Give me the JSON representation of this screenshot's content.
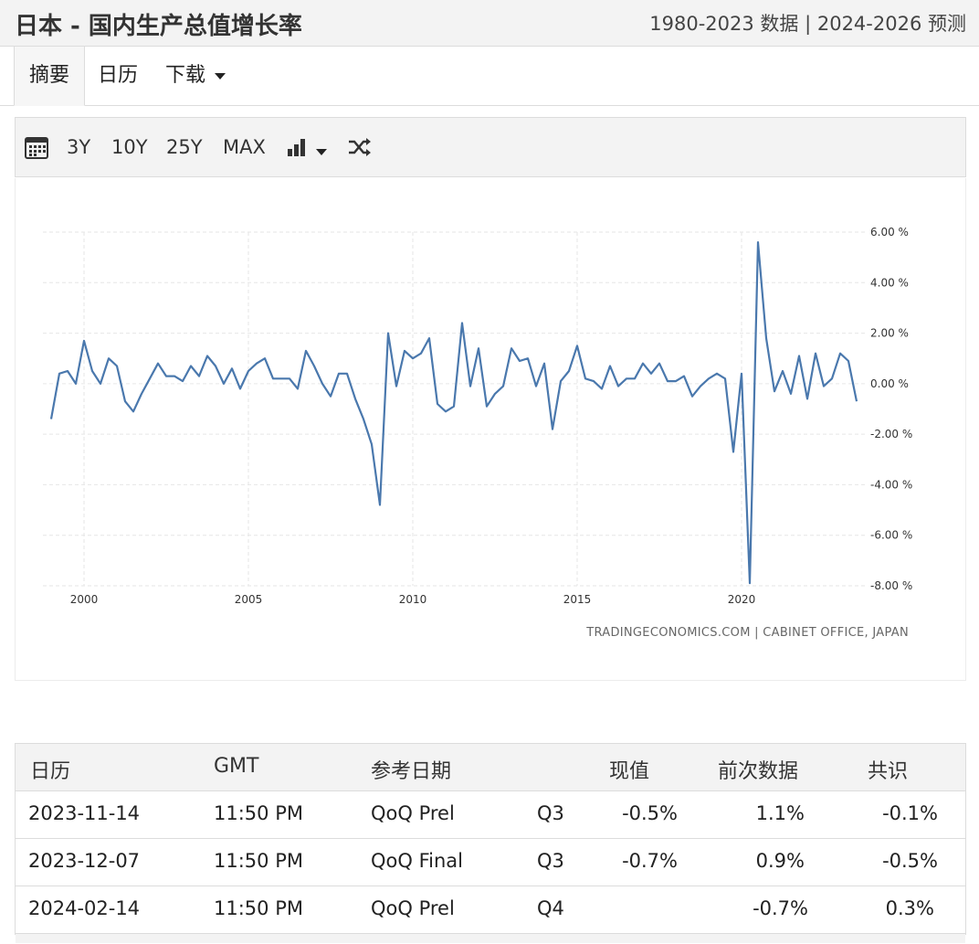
{
  "header": {
    "title": "日本 - 国内生产总值增长率",
    "subtitle": "1980-2023 数据 | 2024-2026 预测"
  },
  "tabs": [
    {
      "label": "摘要",
      "active": true
    },
    {
      "label": "日历"
    },
    {
      "label": "下载"
    }
  ],
  "toolbar": {
    "ranges": [
      "3Y",
      "10Y",
      "25Y",
      "MAX"
    ],
    "icons": [
      "calendar-icon",
      "bar-chart-icon",
      "shuffle-icon"
    ]
  },
  "chart_data": {
    "type": "line",
    "x_start": 1999.0,
    "x_step": 0.25,
    "values": [
      -1.4,
      0.4,
      0.5,
      0.0,
      1.7,
      0.5,
      0.0,
      1.0,
      0.7,
      -0.7,
      -1.1,
      -0.4,
      0.2,
      0.8,
      0.3,
      0.3,
      0.1,
      0.7,
      0.3,
      1.1,
      0.7,
      0.0,
      0.6,
      -0.2,
      0.5,
      0.8,
      1.0,
      0.2,
      0.2,
      0.2,
      -0.2,
      1.3,
      0.7,
      0.0,
      -0.5,
      0.4,
      0.4,
      -0.6,
      -1.4,
      -2.4,
      -4.8,
      2.0,
      -0.1,
      1.3,
      1.0,
      1.2,
      1.8,
      -0.8,
      -1.1,
      -0.9,
      2.4,
      -0.1,
      1.4,
      -0.9,
      -0.4,
      -0.1,
      1.4,
      0.9,
      1.0,
      -0.1,
      0.8,
      -1.8,
      0.1,
      0.5,
      1.5,
      0.2,
      0.1,
      -0.2,
      0.7,
      -0.1,
      0.2,
      0.2,
      0.8,
      0.4,
      0.8,
      0.1,
      0.1,
      0.3,
      -0.5,
      -0.1,
      0.2,
      0.4,
      0.2,
      -2.7,
      0.4,
      -7.9,
      5.6,
      1.8,
      -0.3,
      0.5,
      -0.4,
      1.1,
      -0.6,
      1.2,
      -0.1,
      0.2,
      1.2,
      0.9,
      -0.7
    ],
    "ylim": [
      -8,
      6
    ],
    "y_ticks": [
      "6.00 %",
      "4.00 %",
      "2.00 %",
      "0.00 %",
      "-2.00 %",
      "-4.00 %",
      "-6.00 %",
      "-8.00 %"
    ],
    "y_tick_values": [
      6,
      4,
      2,
      0,
      -2,
      -4,
      -6,
      -8
    ],
    "x_ticks": [
      "2000",
      "2005",
      "2010",
      "2015",
      "2020"
    ],
    "x_tick_values": [
      2000,
      2005,
      2010,
      2015,
      2020
    ],
    "xlim": [
      1998.75,
      2023.75
    ],
    "line_color": "#4a78ad",
    "grid": true,
    "source": "TRADINGECONOMICS.COM | CABINET OFFICE, JAPAN"
  },
  "table": {
    "headers": [
      "日历",
      "GMT",
      "参考日期",
      "",
      "现值",
      "前次数据",
      "共识"
    ],
    "rows": [
      [
        "2023-11-14",
        "11:50 PM",
        "QoQ Prel",
        "Q3",
        "-0.5%",
        "1.1%",
        "-0.1%"
      ],
      [
        "2023-12-07",
        "11:50 PM",
        "QoQ Final",
        "Q3",
        "-0.7%",
        "0.9%",
        "-0.5%"
      ],
      [
        "2024-02-14",
        "11:50 PM",
        "QoQ Prel",
        "Q4",
        "",
        "-0.7%",
        "0.3%"
      ]
    ]
  }
}
